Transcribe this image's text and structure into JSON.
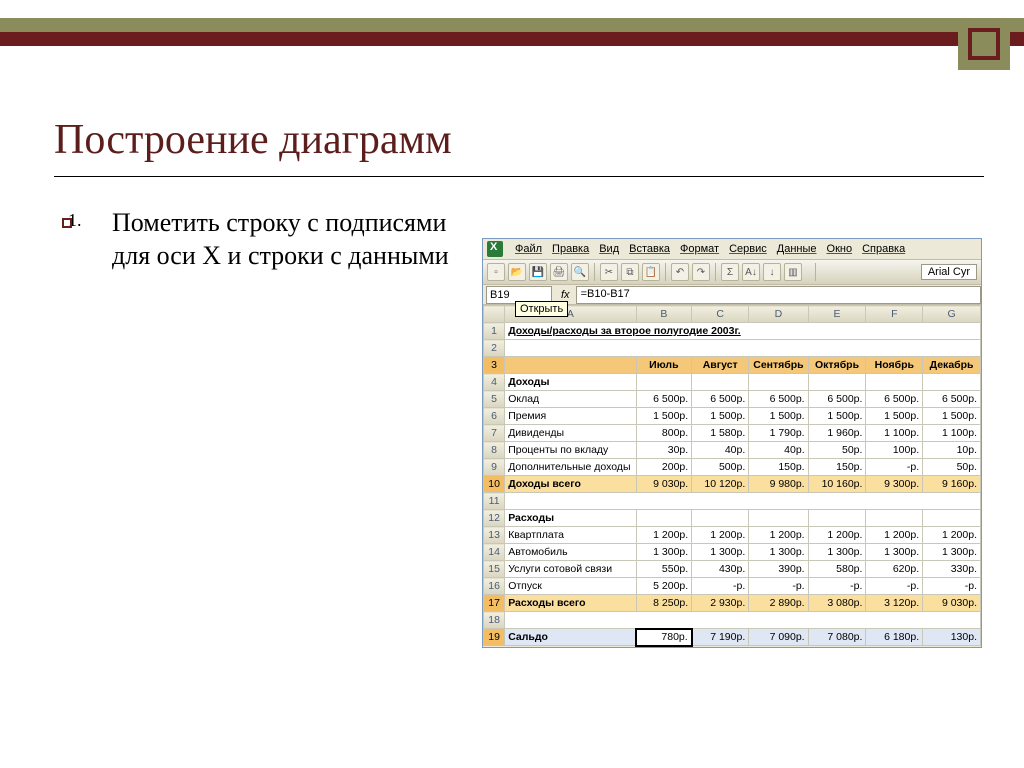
{
  "slide": {
    "title": "Построение диаграмм",
    "list_number": "1.",
    "bullet": "Пометить строку с подписями   для оси X и строки с данными"
  },
  "excel": {
    "menu": [
      "Файл",
      "Правка",
      "Вид",
      "Вставка",
      "Формат",
      "Сервис",
      "Данные",
      "Окно",
      "Справка"
    ],
    "font_name": "Arial Cyr",
    "name_box": "B19",
    "tooltip_open": "Открыть",
    "fx_value": "=B10-B17",
    "cols": [
      "A",
      "B",
      "C",
      "D",
      "E",
      "F",
      "G"
    ],
    "title_row": "Доходы/расходы за второе полугодие 2003г.",
    "months": [
      "Июль",
      "Август",
      "Сентябрь",
      "Октябрь",
      "Ноябрь",
      "Декабрь"
    ],
    "rows": [
      {
        "n": 4,
        "label": "Доходы",
        "kind": "section"
      },
      {
        "n": 5,
        "label": "Оклад",
        "vals": [
          "6 500р.",
          "6 500р.",
          "6 500р.",
          "6 500р.",
          "6 500р.",
          "6 500р."
        ]
      },
      {
        "n": 6,
        "label": "Премия",
        "vals": [
          "1 500р.",
          "1 500р.",
          "1 500р.",
          "1 500р.",
          "1 500р.",
          "1 500р."
        ]
      },
      {
        "n": 7,
        "label": "Дивиденды",
        "vals": [
          "800р.",
          "1 580р.",
          "1 790р.",
          "1 960р.",
          "1 100р.",
          "1 100р."
        ]
      },
      {
        "n": 8,
        "label": "Проценты по вкладу",
        "vals": [
          "30р.",
          "40р.",
          "40р.",
          "50р.",
          "100р.",
          "10р."
        ]
      },
      {
        "n": 9,
        "label": "Дополнительные доходы",
        "vals": [
          "200р.",
          "500р.",
          "150р.",
          "150р.",
          "-р.",
          "50р."
        ]
      },
      {
        "n": 10,
        "label": "Доходы всего",
        "vals": [
          "9 030р.",
          "10 120р.",
          "9 980р.",
          "10 160р.",
          "9 300р.",
          "9 160р."
        ],
        "kind": "total"
      },
      {
        "n": 11,
        "label": "",
        "kind": "blank"
      },
      {
        "n": 12,
        "label": "Расходы",
        "kind": "section"
      },
      {
        "n": 13,
        "label": "Квартплата",
        "vals": [
          "1 200р.",
          "1 200р.",
          "1 200р.",
          "1 200р.",
          "1 200р.",
          "1 200р."
        ]
      },
      {
        "n": 14,
        "label": "Автомобиль",
        "vals": [
          "1 300р.",
          "1 300р.",
          "1 300р.",
          "1 300р.",
          "1 300р.",
          "1 300р."
        ]
      },
      {
        "n": 15,
        "label": "Услуги сотовой связи",
        "vals": [
          "550р.",
          "430р.",
          "390р.",
          "580р.",
          "620р.",
          "330р."
        ]
      },
      {
        "n": 16,
        "label": "Отпуск",
        "vals": [
          "5 200р.",
          "-р.",
          "-р.",
          "-р.",
          "-р.",
          "-р."
        ]
      },
      {
        "n": 17,
        "label": "Расходы всего",
        "vals": [
          "8 250р.",
          "2 930р.",
          "2 890р.",
          "3 080р.",
          "3 120р.",
          "9 030р."
        ],
        "kind": "total"
      },
      {
        "n": 18,
        "label": "",
        "kind": "blank"
      },
      {
        "n": 19,
        "label": "Сальдо",
        "vals": [
          "780р.",
          "7 190р.",
          "7 090р.",
          "7 080р.",
          "6 180р.",
          "130р."
        ],
        "kind": "selrow"
      }
    ]
  },
  "chart_data": {
    "type": "table",
    "title": "Доходы/расходы за второе полугодие 2003г.",
    "categories": [
      "Июль",
      "Август",
      "Сентябрь",
      "Октябрь",
      "Ноябрь",
      "Декабрь"
    ],
    "series": [
      {
        "name": "Оклад",
        "values": [
          6500,
          6500,
          6500,
          6500,
          6500,
          6500
        ]
      },
      {
        "name": "Премия",
        "values": [
          1500,
          1500,
          1500,
          1500,
          1500,
          1500
        ]
      },
      {
        "name": "Дивиденды",
        "values": [
          800,
          1580,
          1790,
          1960,
          1100,
          1100
        ]
      },
      {
        "name": "Проценты по вкладу",
        "values": [
          30,
          40,
          40,
          50,
          100,
          10
        ]
      },
      {
        "name": "Дополнительные доходы",
        "values": [
          200,
          500,
          150,
          150,
          0,
          50
        ]
      },
      {
        "name": "Доходы всего",
        "values": [
          9030,
          10120,
          9980,
          10160,
          9300,
          9160
        ]
      },
      {
        "name": "Квартплата",
        "values": [
          1200,
          1200,
          1200,
          1200,
          1200,
          1200
        ]
      },
      {
        "name": "Автомобиль",
        "values": [
          1300,
          1300,
          1300,
          1300,
          1300,
          1300
        ]
      },
      {
        "name": "Услуги сотовой связи",
        "values": [
          550,
          430,
          390,
          580,
          620,
          330
        ]
      },
      {
        "name": "Отпуск",
        "values": [
          5200,
          0,
          0,
          0,
          0,
          0
        ]
      },
      {
        "name": "Расходы всего",
        "values": [
          8250,
          2930,
          2890,
          3080,
          3120,
          9030
        ]
      },
      {
        "name": "Сальдо",
        "values": [
          780,
          7190,
          7090,
          7080,
          6180,
          130
        ]
      }
    ]
  }
}
